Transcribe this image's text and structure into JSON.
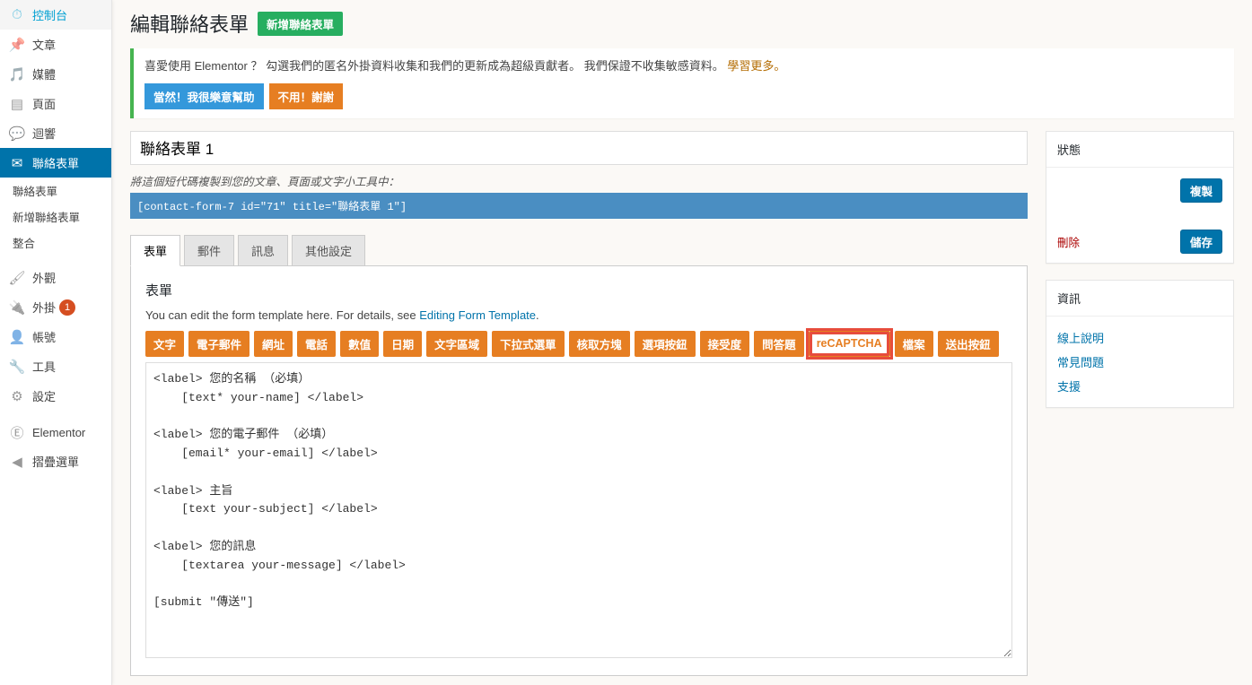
{
  "sidebar": {
    "items": [
      {
        "icon": "gauge",
        "label": "控制台"
      },
      {
        "icon": "pin",
        "label": "文章"
      },
      {
        "icon": "media",
        "label": "媒體"
      },
      {
        "icon": "page",
        "label": "頁面"
      },
      {
        "icon": "comment",
        "label": "迴響"
      },
      {
        "icon": "mail",
        "label": "聯絡表單",
        "active": true
      }
    ],
    "sub_contact": [
      "聯絡表單",
      "新增聯絡表單",
      "整合"
    ],
    "items2": [
      {
        "icon": "brush",
        "label": "外觀"
      },
      {
        "icon": "plug",
        "label": "外掛",
        "badge": "1"
      },
      {
        "icon": "user",
        "label": "帳號"
      },
      {
        "icon": "tool",
        "label": "工具"
      },
      {
        "icon": "gear",
        "label": "設定"
      }
    ],
    "items3": [
      {
        "icon": "elementor",
        "label": "Elementor"
      },
      {
        "icon": "collapse",
        "label": "摺疊選單"
      }
    ]
  },
  "header": {
    "title": "編輯聯絡表單",
    "add_new": "新增聯絡表單"
  },
  "notice": {
    "text1": "喜愛使用 Elementor ？ 勾選我們的匿名外掛資料收集和我們的更新成為超級貢獻者。",
    "text2": "我們保證不收集敏感資料。",
    "link": "學習更多。",
    "btn_yes": "當然！我很樂意幫助",
    "btn_no": "不用！謝謝"
  },
  "form": {
    "title_value": "聯絡表單 1",
    "shortcode_label": "將這個短代碼複製到您的文章、頁面或文字小工具中：",
    "shortcode": "[contact-form-7 id=\"71\" title=\"聯絡表單 1\"]"
  },
  "tabs": [
    "表單",
    "郵件",
    "訊息",
    "其他設定"
  ],
  "panel": {
    "heading": "表單",
    "desc_prefix": "You can edit the form template here. For details, see ",
    "desc_link": "Editing Form Template",
    "desc_suffix": ".",
    "tags": [
      "文字",
      "電子郵件",
      "網址",
      "電話",
      "數值",
      "日期",
      "文字區域",
      "下拉式選單",
      "核取方塊",
      "選項按鈕",
      "接受度",
      "問答題",
      "reCAPTCHA",
      "檔案",
      "送出按鈕"
    ],
    "template": "<label> 您的名稱 （必填）\n    [text* your-name] </label>\n\n<label> 您的電子郵件 （必填）\n    [email* your-email] </label>\n\n<label> 主旨\n    [text your-subject] </label>\n\n<label> 您的訊息\n    [textarea your-message] </label>\n\n[submit \"傳送\"]"
  },
  "status_box": {
    "title": "狀態",
    "copy": "複製",
    "delete": "刪除",
    "save": "儲存"
  },
  "info_box": {
    "title": "資訊",
    "links": [
      "線上說明",
      "常見問題",
      "支援"
    ]
  }
}
